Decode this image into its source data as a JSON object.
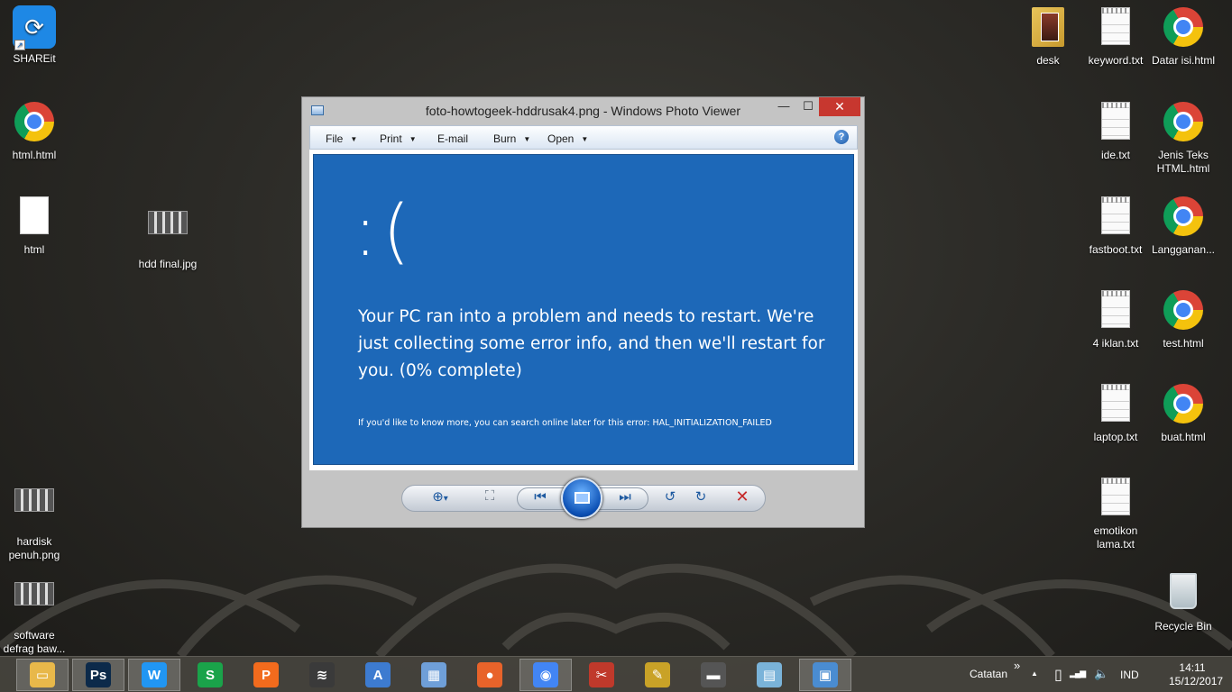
{
  "desktop": {
    "icons_left": [
      {
        "label": "SHAREit",
        "type": "shareit"
      },
      {
        "label": "html.html",
        "type": "chrome"
      },
      {
        "label": "html",
        "type": "blank"
      },
      {
        "label": "hdd final.jpg",
        "type": "image"
      },
      {
        "label": "hardisk penuh.png",
        "type": "image"
      },
      {
        "label": "software defrag baw...",
        "type": "image"
      }
    ],
    "icons_right": [
      {
        "label": "desk",
        "type": "folder"
      },
      {
        "label": "keyword.txt",
        "type": "txt"
      },
      {
        "label": "Datar isi.html",
        "type": "chrome"
      },
      {
        "label": "ide.txt",
        "type": "txt"
      },
      {
        "label": "Jenis Teks HTML.html",
        "type": "chrome"
      },
      {
        "label": "fastboot.txt",
        "type": "txt"
      },
      {
        "label": "Langganan...",
        "type": "chrome"
      },
      {
        "label": "4 iklan.txt",
        "type": "txt"
      },
      {
        "label": "test.html",
        "type": "chrome"
      },
      {
        "label": "laptop.txt",
        "type": "txt"
      },
      {
        "label": "buat.html",
        "type": "chrome"
      },
      {
        "label": "emotikon lama.txt",
        "type": "txt"
      },
      {
        "label": "Recycle Bin",
        "type": "recycle-bin"
      }
    ]
  },
  "viewer": {
    "title": "foto-howtogeek-hddrusak4.png - Windows Photo Viewer",
    "window_buttons": {
      "minimize": "—",
      "maximize": "☐",
      "close": "✕"
    },
    "menu": [
      {
        "label": "File",
        "dropdown": true
      },
      {
        "label": "Print",
        "dropdown": true
      },
      {
        "label": "E-mail",
        "dropdown": false
      },
      {
        "label": "Burn",
        "dropdown": true
      },
      {
        "label": "Open",
        "dropdown": true
      }
    ],
    "help_label": "?",
    "image": {
      "sad_face": ":(",
      "message": "Your PC ran into a problem and needs to restart. We're just collecting some error info, and then we'll restart for you. (0% complete)",
      "footer": "If you'd like to know more, you can search online later for this error: HAL_INITIALIZATION_FAILED"
    },
    "controls": {
      "zoom_icon": "⊕",
      "zoom_caret": "▾",
      "fit_icon": "⛶",
      "prev_icon": "⏮",
      "next_icon": "⏭",
      "rotate_ccw_icon": "↺",
      "rotate_cw_icon": "↻",
      "delete_icon": "✕"
    }
  },
  "taskbar": {
    "apps": [
      {
        "name": "file-explorer",
        "color": "#e8b84a",
        "glyph": "▭"
      },
      {
        "name": "photoshop",
        "color": "#0c2a4a",
        "glyph": "Ps"
      },
      {
        "name": "wps-writer",
        "color": "#2196f3",
        "glyph": "W"
      },
      {
        "name": "wps-spreadsheets",
        "color": "#1aa34a",
        "glyph": "S"
      },
      {
        "name": "wps-presentation",
        "color": "#f26b1d",
        "glyph": "P"
      },
      {
        "name": "wifi-app",
        "color": "#3a3a3a",
        "glyph": "≋"
      },
      {
        "name": "wordpad",
        "color": "#3d7bd0",
        "glyph": "A"
      },
      {
        "name": "calculator",
        "color": "#6f9fd8",
        "glyph": "▦"
      },
      {
        "name": "firefox",
        "color": "#e8632a",
        "glyph": "●"
      },
      {
        "name": "chrome",
        "color": "#4285f4",
        "glyph": "◉"
      },
      {
        "name": "snipping-tool",
        "color": "#c0392b",
        "glyph": "✂"
      },
      {
        "name": "paint",
        "color": "#c9a227",
        "glyph": "✎"
      },
      {
        "name": "usb-drive",
        "color": "#555555",
        "glyph": "▬"
      },
      {
        "name": "notepad",
        "color": "#7ab3d9",
        "glyph": "▤"
      },
      {
        "name": "photo-viewer",
        "color": "#4a8cd1",
        "glyph": "▣"
      }
    ],
    "toolbar_label": "Catatan",
    "chevron": "»",
    "tray_up": "▲",
    "battery_icon": "▯",
    "signal_icon": "▂▄▆",
    "volume_icon": "🔈",
    "language": "IND",
    "time": "14:11",
    "date": "15/12/2017"
  }
}
